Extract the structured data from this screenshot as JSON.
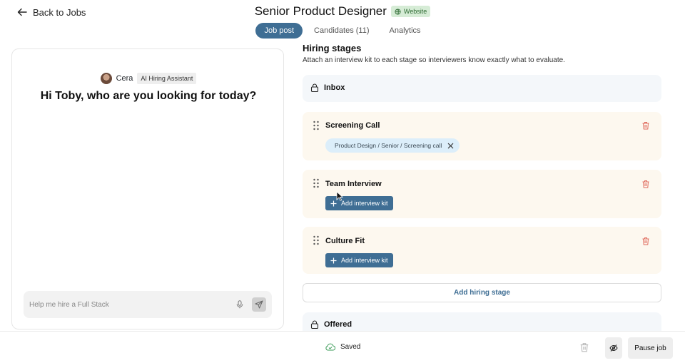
{
  "header": {
    "back_label": "Back to Jobs",
    "job_title": "Senior Product Designer",
    "badge_label": "Website"
  },
  "tabs": [
    {
      "label": "Job post",
      "active": true
    },
    {
      "label": "Candidates (11)",
      "active": false
    },
    {
      "label": "Analytics",
      "active": false
    }
  ],
  "chat": {
    "assistant_name": "Cera",
    "assistant_role": "AI Hiring Assistant",
    "greeting": "Hi Toby, who are you looking for today?",
    "input_placeholder": "Help me hire a Full Stack",
    "input_value": ""
  },
  "stages": {
    "heading": "Hiring stages",
    "description": "Attach an interview kit to each stage so interviewers know exactly what to evaluate.",
    "inbox_label": "Inbox",
    "items": [
      {
        "label": "Screening Call",
        "kit": "Product Design / Senior / Screening call"
      },
      {
        "label": "Team Interview",
        "add_kit_label": "Add interview kit"
      },
      {
        "label": "Culture Fit",
        "add_kit_label": "Add interview kit"
      }
    ],
    "add_stage_label": "Add hiring stage",
    "offered_label": "Offered"
  },
  "footer": {
    "saved_label": "Saved",
    "pause_label": "Pause job"
  },
  "colors": {
    "accent": "#3f6e94",
    "badge_bg": "#d6ecd6",
    "stage_bg": "#fdf8ef",
    "locked_stage_bg": "#f4f7fa",
    "trash": "#e06a5c"
  },
  "icons": [
    "arrow-left-icon",
    "globe-icon",
    "microphone-icon",
    "send-icon",
    "lock-icon",
    "drag-handle-icon",
    "trash-icon",
    "close-icon",
    "plus-icon",
    "cloud-check-icon",
    "eye-off-icon",
    "mouse-cursor-icon"
  ]
}
